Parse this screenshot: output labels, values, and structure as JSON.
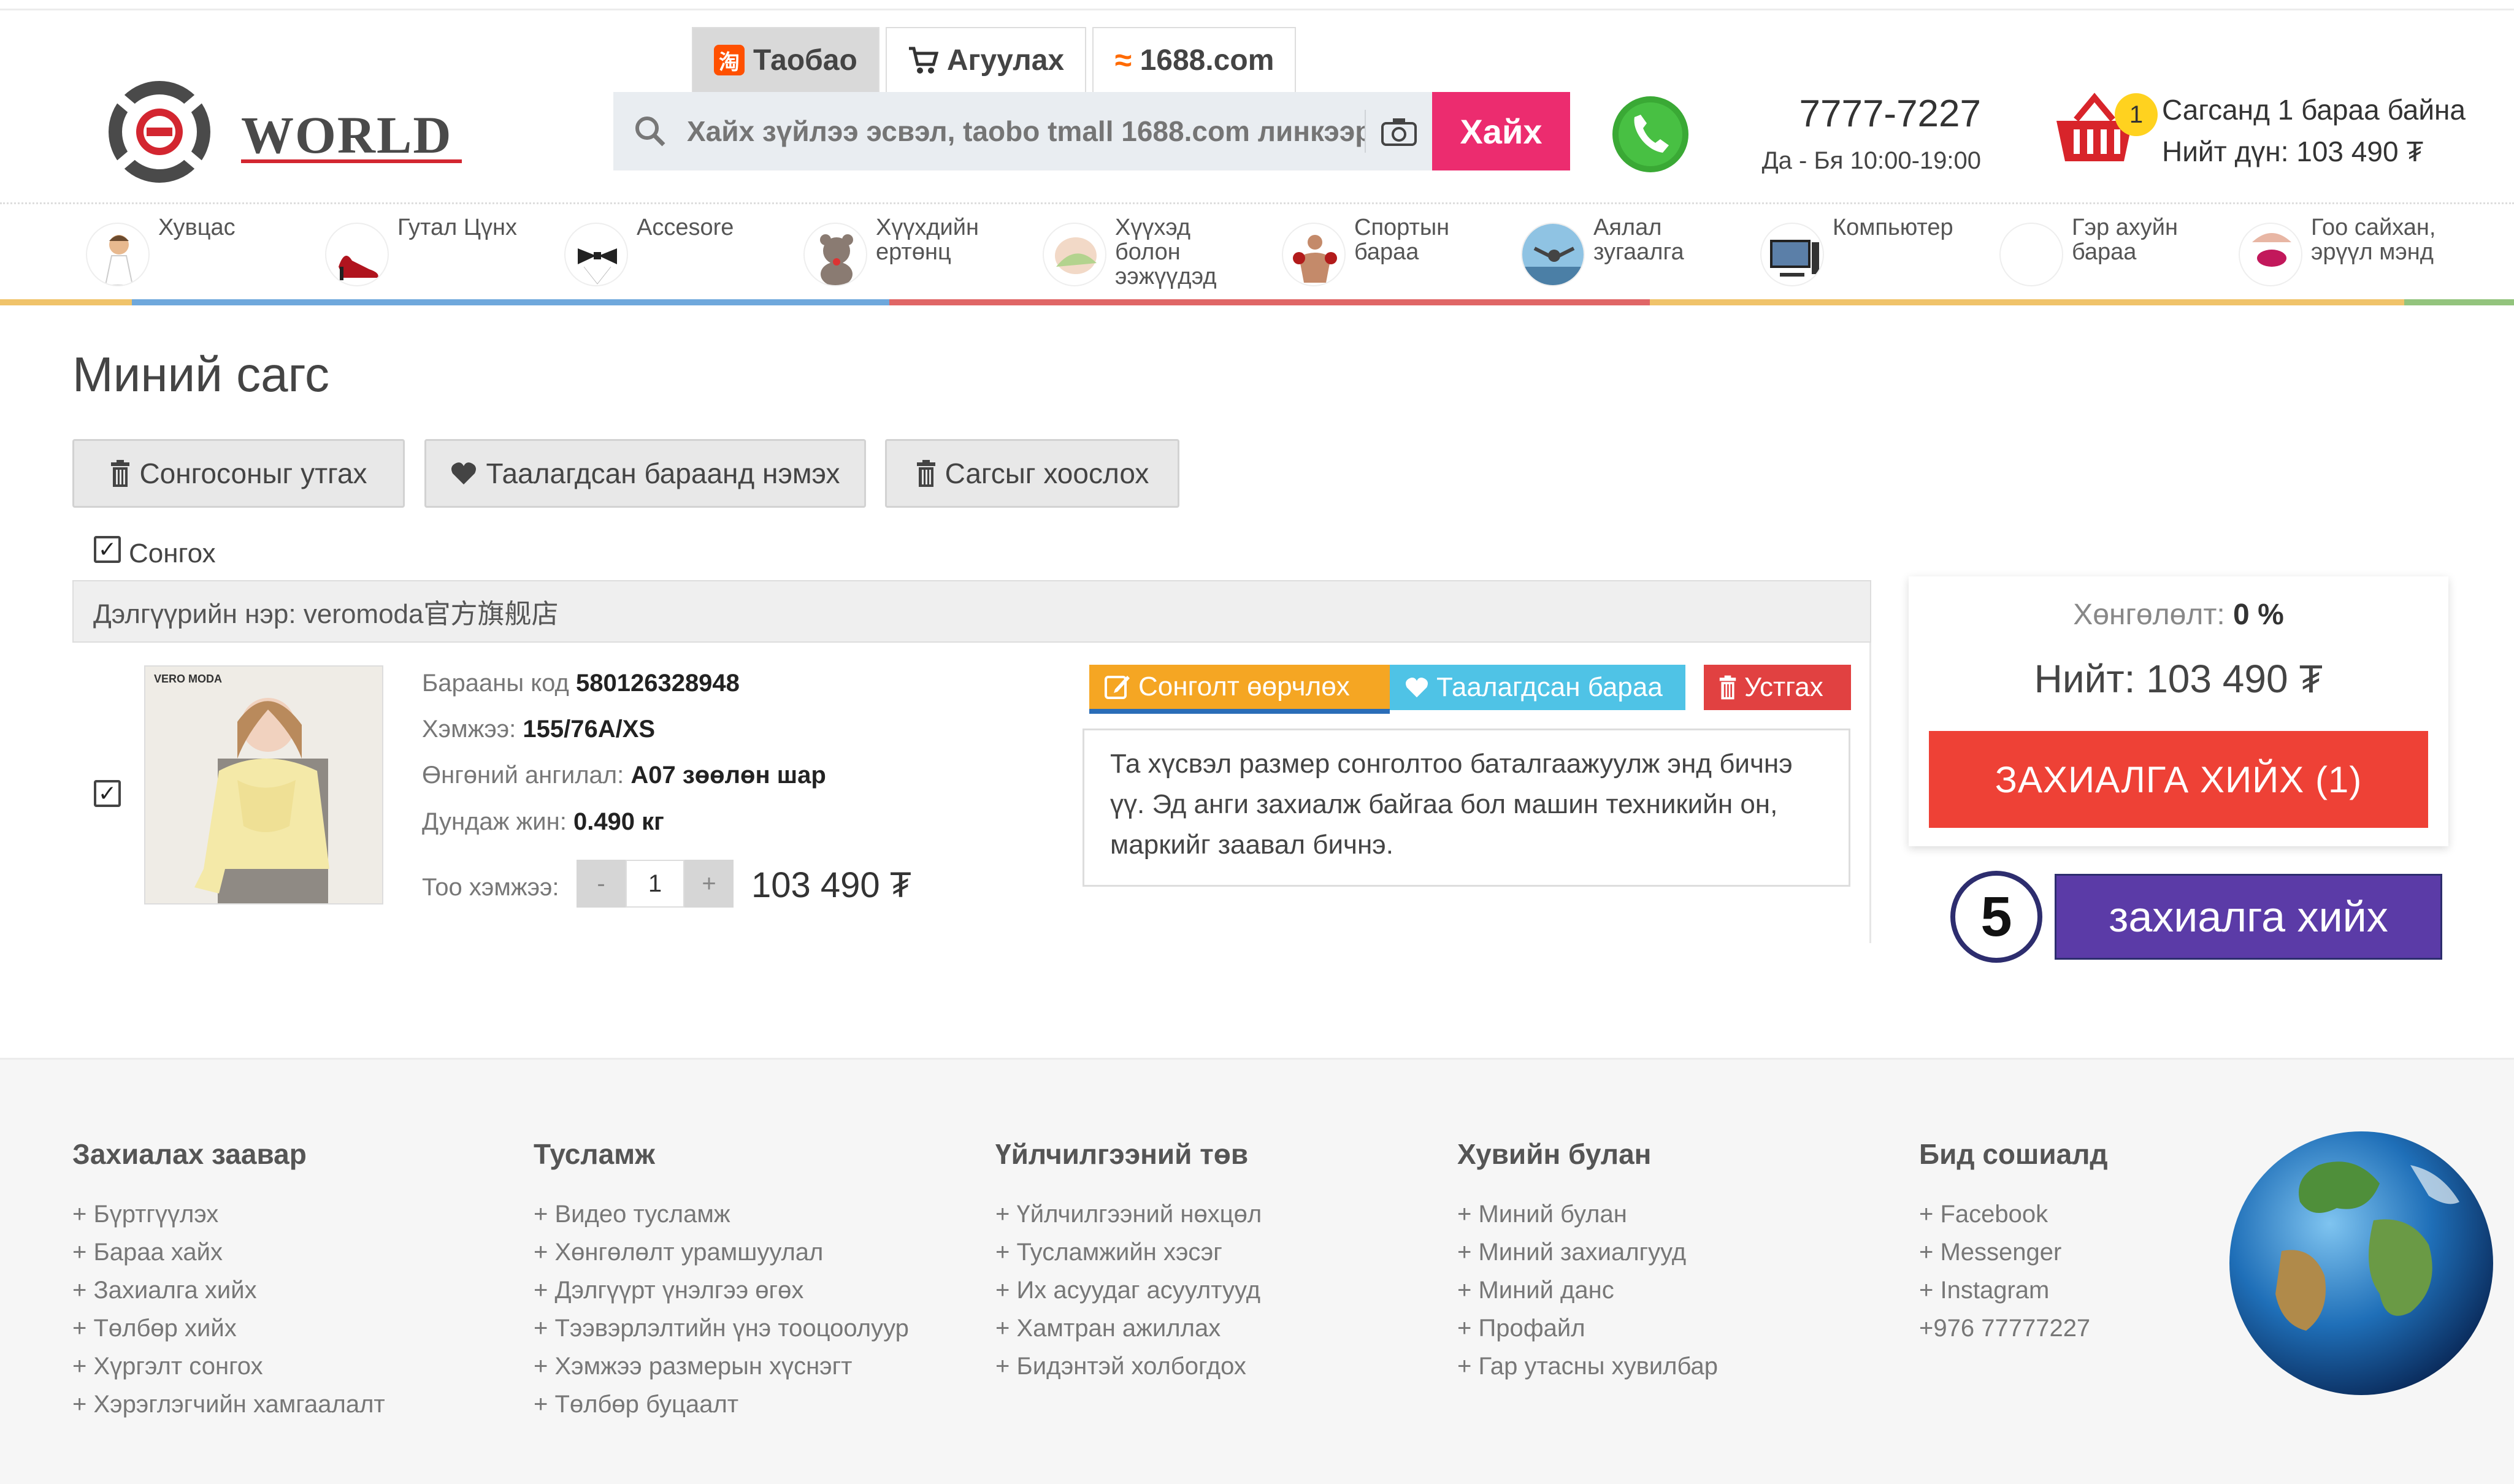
{
  "header": {
    "logo_text": "WORLD",
    "tabs": [
      {
        "label": "Таобао",
        "icon": "taobao-icon",
        "active": true
      },
      {
        "label": "Агуулах",
        "icon": "cart-small-icon",
        "active": false
      },
      {
        "label": "1688.com",
        "icon": "alibaba-icon",
        "active": false
      }
    ],
    "search": {
      "placeholder": "Хайх зүйлээ эсвэл, taobo tmall 1688.com линкээр",
      "button_label": "Хайх"
    },
    "phone": {
      "number": "7777-7227",
      "hours": "Да - Бя 10:00-19:00"
    },
    "cart": {
      "count": "1",
      "line1": "Сагсанд 1 бараа байна",
      "line2": "Нийт дүн: 103 490 ₮"
    }
  },
  "categories": [
    {
      "label": "Хувцас"
    },
    {
      "label": "Гутал Цүнх"
    },
    {
      "label": "Accesore"
    },
    {
      "label": "Хүүхдийн ертөнц"
    },
    {
      "label": "Хүүхэд болон ээжүүдэд"
    },
    {
      "label": "Спортын бараа"
    },
    {
      "label": "Аялал зугаалга"
    },
    {
      "label": "Компьютер"
    },
    {
      "label": "Гэр ахуйн бараа"
    },
    {
      "label": "Гоо сайхан, эрүүл мэнд"
    }
  ],
  "cart_page": {
    "title": "Миний сагс",
    "buttons": {
      "delete_selected": "Сонгосоныг утгах",
      "add_favorite": "Таалагдсан бараанд нэмэх",
      "clear_cart": "Сагсыг хоослох"
    },
    "select_all_label": "Сонгох",
    "shop_header": "Дэлгүүрийн нэр: veromoda官方旗舰店",
    "item": {
      "brand_label": "VERO MODA",
      "code_label": "Барааны код",
      "code_value": "580126328948",
      "size_label": "Хэмжээ:",
      "size_value": "155/76A/XS",
      "color_label": "Өнгөний ангилал:",
      "color_value": "A07 зөөлөн шар",
      "weight_label": "Дундаж жин:",
      "weight_value": "0.490 кг",
      "qty_label": "Тоо хэмжээ:",
      "qty_value": "1",
      "qty_minus": "-",
      "qty_plus": "+",
      "price": "103 490 ₮",
      "edit_label": "Сонголт өөрчлөх",
      "like_label": "Таалагдсан бараа",
      "remove_label": "Устгах",
      "note": "Та хүсвэл размер сонголтоо баталгаажуулж энд бичнэ үү. Эд анги захиалж байгаа бол машин техникийн он, маркийг заавал бичнэ."
    },
    "summary": {
      "discount_label": "Хөнгөлөлт:",
      "discount_value": "0 %",
      "total": "Нийт: 103 490 ₮",
      "order_button": "ЗАХИАЛГА ХИЙХ (1)"
    },
    "step": {
      "number": "5",
      "label": "захиалга хийх"
    }
  },
  "footer": {
    "columns": [
      {
        "heading": "Захиалах заавар",
        "items": [
          "+ Бүртгүүлэх",
          "+ Бараа хайх",
          "+ Захиалга хийх",
          "+ Төлбөр хийх",
          "+ Хүргэлт сонгох",
          "+ Хэрэглэгчийн хамгаалалт"
        ]
      },
      {
        "heading": "Тусламж",
        "items": [
          "+ Видео тусламж",
          "+ Хөнгөлөлт урамшуулал",
          "+ Дэлгүүрт үнэлгээ өгөх",
          "+ Тээвэрлэлтийн үнэ тооцоолуур",
          "+ Хэмжээ размерын хүснэгт",
          "+ Төлбөр буцаалт"
        ]
      },
      {
        "heading": "Үйлчилгээний төв",
        "items": [
          "+ Үйлчилгээний нөхцөл",
          "+ Тусламжийн хэсэг",
          "+ Их асуудаг асуултууд",
          "+ Хамтран ажиллах",
          "+ Бидэнтэй холбогдох"
        ]
      },
      {
        "heading": "Хувийн булан",
        "items": [
          "+ Миний булан",
          "+ Миний захиалгууд",
          "+ Миний данс",
          "+ Профайл",
          "+ Гар утасны хувилбар"
        ]
      },
      {
        "heading": "Бид сошиалд",
        "items": [
          "+ Facebook",
          "+ Messenger",
          "+ Instagram",
          "+976 77777227"
        ]
      }
    ]
  },
  "colors": {
    "accent_pink": "#ec2c6f",
    "order_red": "#ee4136",
    "edit_orange": "#f5a623",
    "like_blue": "#4fc3e6",
    "remove_red": "#e14141",
    "step_purple": "#5b3ba7",
    "category_line": [
      "#f0c36a",
      "#6fa8dc",
      "#6fa8dc",
      "#e06666",
      "#e06666",
      "#f0c36a",
      "#f0c36a",
      "#93c47d"
    ]
  }
}
